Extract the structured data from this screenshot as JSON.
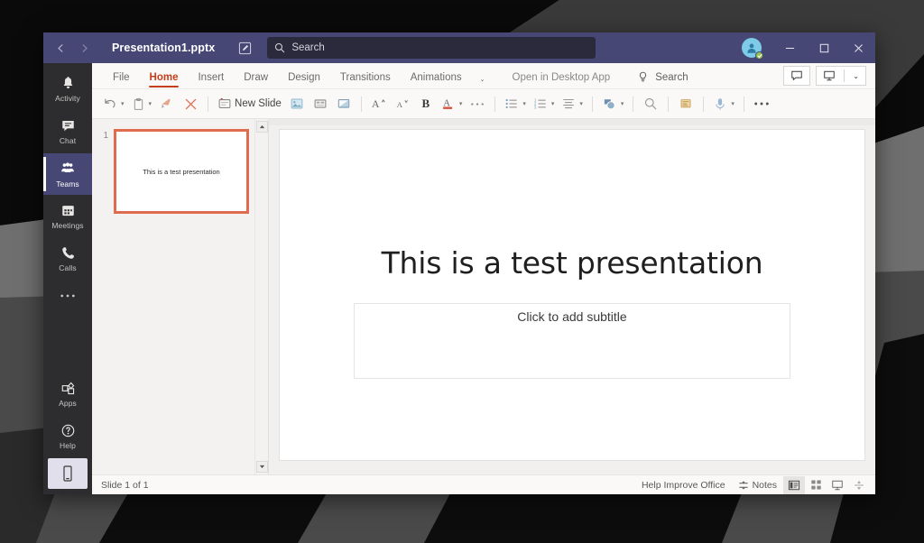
{
  "window": {
    "title": "Presentation1.pptx",
    "nav_back": "‹",
    "nav_forward": "›",
    "edit_icon": "edit-square-icon",
    "minimize": "–",
    "maximize": "□",
    "close": "✕"
  },
  "search": {
    "placeholder": "Search",
    "icon": "search-icon"
  },
  "avatar": {
    "name": "avatar",
    "status": "available"
  },
  "rail": {
    "items": [
      {
        "label": "Activity",
        "icon": "bell-icon",
        "active": false
      },
      {
        "label": "Chat",
        "icon": "chat-bubble-icon",
        "active": false
      },
      {
        "label": "Teams",
        "icon": "teams-people-icon",
        "active": true
      },
      {
        "label": "Meetings",
        "icon": "calendar-icon",
        "active": false
      },
      {
        "label": "Calls",
        "icon": "phone-icon",
        "active": false
      },
      {
        "label": "",
        "icon": "more-dots-icon",
        "active": false
      },
      {
        "label": "Apps",
        "icon": "apps-grid-icon",
        "active": false
      },
      {
        "label": "Help",
        "icon": "help-circle-icon",
        "active": false
      }
    ],
    "bottom": {
      "label": "",
      "icon": "mobile-phone-icon"
    }
  },
  "ribbon": {
    "tabs": [
      {
        "label": "File",
        "active": false
      },
      {
        "label": "Home",
        "active": true
      },
      {
        "label": "Insert",
        "active": false
      },
      {
        "label": "Draw",
        "active": false
      },
      {
        "label": "Design",
        "active": false
      },
      {
        "label": "Transitions",
        "active": false
      },
      {
        "label": "Animations",
        "active": false
      }
    ],
    "tabs_overflow": "⌄",
    "open_desktop": "Open in Desktop App",
    "search_label": "Search",
    "search_icon": "lightbulb-icon",
    "comments_icon": "comment-icon",
    "present_icon": "present-screen-icon",
    "present_chevron": "⌄"
  },
  "toolbar": {
    "items": [
      {
        "name": "undo-button",
        "icon": "undo-arrow-icon",
        "label": "",
        "chevron": true
      },
      {
        "name": "paste-button",
        "icon": "clipboard-icon",
        "label": "",
        "chevron": true
      },
      {
        "name": "format-painter-button",
        "icon": "format-painter-icon",
        "label": "",
        "chevron": false
      },
      {
        "name": "clear-formatting-button",
        "icon": "red-x-icon",
        "label": "",
        "chevron": false
      },
      {
        "name": "new-slide-button",
        "icon": "new-slide-icon",
        "label": "New Slide",
        "chevron": false
      },
      {
        "name": "picture-button",
        "icon": "picture-icon",
        "label": "",
        "chevron": false
      },
      {
        "name": "layout-button",
        "icon": "slide-layout-icon",
        "label": "",
        "chevron": false
      },
      {
        "name": "shape-button",
        "icon": "shape-fill-icon",
        "label": "",
        "chevron": false
      },
      {
        "name": "grow-font-button",
        "icon": "grow-font-icon",
        "label": "",
        "chevron": false
      },
      {
        "name": "shrink-font-button",
        "icon": "shrink-font-icon",
        "label": "",
        "chevron": false
      },
      {
        "name": "bold-button",
        "icon": "bold-icon",
        "label": "B",
        "chevron": false
      },
      {
        "name": "font-color-button",
        "icon": "font-color-icon",
        "label": "",
        "chevron": true
      },
      {
        "name": "more-font-options-button",
        "icon": "more-dots-icon",
        "label": "",
        "chevron": false
      },
      {
        "name": "bullets-button",
        "icon": "bullet-list-icon",
        "label": "",
        "chevron": true
      },
      {
        "name": "numbering-button",
        "icon": "numbered-list-icon",
        "label": "",
        "chevron": true
      },
      {
        "name": "align-button",
        "icon": "align-text-icon",
        "label": "",
        "chevron": true
      },
      {
        "name": "shape-styles-button",
        "icon": "shapes-icon",
        "label": "",
        "chevron": true
      },
      {
        "name": "find-button",
        "icon": "magnifier-icon",
        "label": "",
        "chevron": false
      },
      {
        "name": "designer-button",
        "icon": "designer-icon",
        "label": "",
        "chevron": false
      },
      {
        "name": "dictate-button",
        "icon": "microphone-icon",
        "label": "",
        "chevron": true
      },
      {
        "name": "more-commands-button",
        "icon": "more-dots-icon",
        "label": "",
        "chevron": false
      }
    ],
    "bold_label": "B"
  },
  "thumbnails": {
    "scroll_up": "▲",
    "scroll_down": "▼",
    "slides": [
      {
        "number": "1",
        "text": "This is a test presentation",
        "selected": true
      }
    ]
  },
  "slide": {
    "title": "This is a test presentation",
    "subtitle_placeholder": "Click to add subtitle"
  },
  "statusbar": {
    "slide_count": "Slide 1 of 1",
    "help_improve": "Help Improve Office",
    "notes_label": "Notes",
    "notes_icon": "notes-icon",
    "views": [
      {
        "name": "normal-view-button",
        "icon": "normal-view-icon",
        "selected": true
      },
      {
        "name": "slide-sorter-button",
        "icon": "slide-sorter-icon",
        "selected": false
      },
      {
        "name": "reading-view-button",
        "icon": "reading-view-icon",
        "selected": false
      },
      {
        "name": "fit-slide-button",
        "icon": "fit-to-window-icon",
        "selected": false
      }
    ]
  },
  "colors": {
    "teams_purple": "#464775",
    "accent_red": "#c43e1c",
    "thumb_border": "#e06c4f",
    "status_green": "#92c353"
  }
}
